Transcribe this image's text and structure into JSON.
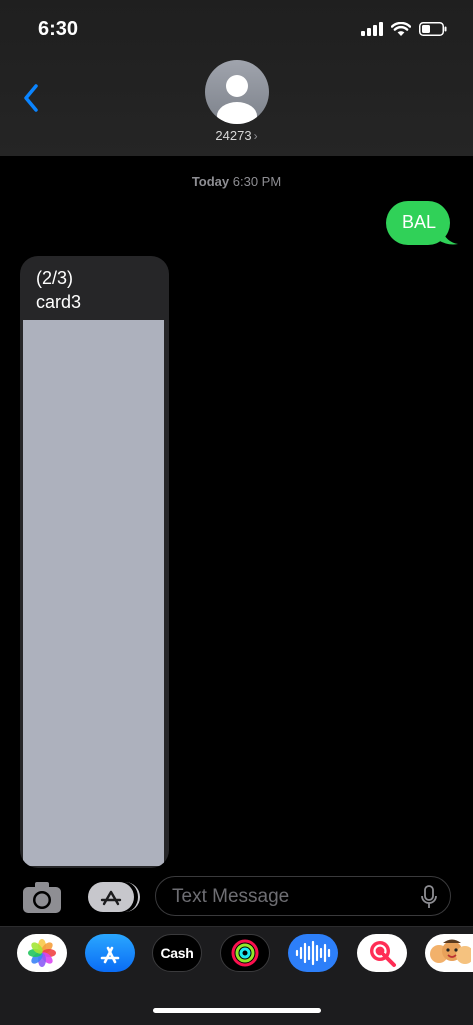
{
  "status": {
    "time": "6:30"
  },
  "header": {
    "contact": "24273",
    "chevron": "›"
  },
  "thread": {
    "timestamp_day": "Today",
    "timestamp_time": "6:30 PM",
    "messages": [
      {
        "direction": "sent",
        "text": "BAL"
      },
      {
        "direction": "received",
        "lines": [
          "(2/3)",
          "card3"
        ]
      }
    ]
  },
  "composer": {
    "placeholder": "Text Message"
  },
  "app_drawer": {
    "apps": [
      {
        "name": "photos-icon"
      },
      {
        "name": "app-store-icon"
      },
      {
        "name": "apple-cash-icon",
        "label": "Cash",
        "logo": ""
      },
      {
        "name": "activity-icon"
      },
      {
        "name": "audio-message-icon"
      },
      {
        "name": "images-search-icon"
      },
      {
        "name": "memoji-icon"
      }
    ]
  },
  "colors": {
    "accent": "#0a84ff",
    "sent_bubble": "#30d158",
    "received_bubble": "#262628"
  }
}
